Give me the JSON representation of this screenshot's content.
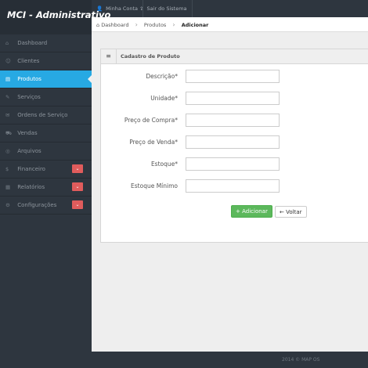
{
  "app": {
    "title": "MCI - Administrativo"
  },
  "topbar": {
    "links": [
      {
        "icon": "user-icon",
        "glyph": "👤",
        "label": "Minha Conta"
      },
      {
        "icon": "share-icon",
        "glyph": "⇪",
        "label": "Sair do Sistema"
      }
    ]
  },
  "sidebar": {
    "items": [
      {
        "label": "Dashboard",
        "glyph": "⌂",
        "icon": "home-icon"
      },
      {
        "label": "Clientes",
        "glyph": "☺",
        "icon": "group-icon"
      },
      {
        "label": "Produtos",
        "glyph": "▤",
        "icon": "barcode-icon",
        "active": true
      },
      {
        "label": "Serviços",
        "glyph": "✎",
        "icon": "wrench-icon"
      },
      {
        "label": "Ordens de Serviço",
        "glyph": "✉",
        "icon": "tags-icon"
      },
      {
        "label": "Vendas",
        "glyph": "⛟",
        "icon": "cart-icon"
      },
      {
        "label": "Arquivos",
        "glyph": "◎",
        "icon": "hdd-icon"
      },
      {
        "label": "Financeiro",
        "glyph": "$",
        "icon": "money-icon",
        "badge": "⌄"
      },
      {
        "label": "Relatórios",
        "glyph": "▦",
        "icon": "list-alt-icon",
        "badge": "⌄"
      },
      {
        "label": "Configurações",
        "glyph": "⚙",
        "icon": "cog-icon",
        "badge": "⌄"
      }
    ]
  },
  "breadcrumb": {
    "home_glyph": "⌂",
    "items": [
      "Dashboard",
      "Produtos",
      "Adicionar"
    ]
  },
  "widget": {
    "icon_glyph": "≡",
    "title": "Cadastro de Produto"
  },
  "form": {
    "fields": [
      {
        "label": "Descrição*",
        "value": ""
      },
      {
        "label": "Unidade*",
        "value": ""
      },
      {
        "label": "Preço de Compra*",
        "value": ""
      },
      {
        "label": "Preço de Venda*",
        "value": ""
      },
      {
        "label": "Estoque*",
        "value": ""
      },
      {
        "label": "Estoque Mínimo",
        "value": ""
      }
    ],
    "submit": {
      "glyph": "+",
      "label": "Adicionar"
    },
    "back": {
      "glyph": "←",
      "label": "Voltar"
    }
  },
  "footer": {
    "text": "2014 © MAP OS"
  },
  "colors": {
    "accent": "#27a9e3",
    "success": "#5cb85c",
    "danger": "#e05c5c",
    "dark": "#2e363f"
  }
}
